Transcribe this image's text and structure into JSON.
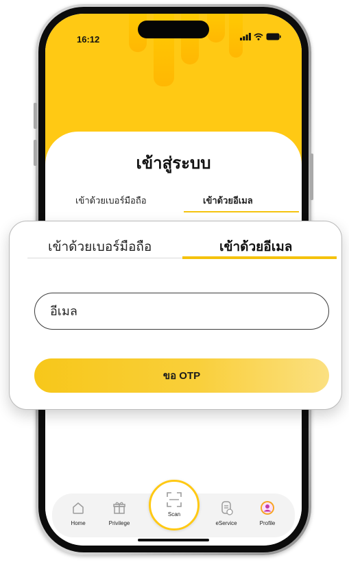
{
  "status_bar": {
    "time": "16:12"
  },
  "login": {
    "title": "เข้าสู่ระบบ",
    "tabs": [
      {
        "label": "เข้าด้วยเบอร์มือถือ",
        "active": false
      },
      {
        "label": "เข้าด้วยอีเมล",
        "active": true
      }
    ]
  },
  "email_form": {
    "email_placeholder": "อีเมล",
    "email_value": "",
    "otp_button_label": "ขอ OTP"
  },
  "bottom_nav": {
    "items": [
      {
        "label": "Home",
        "icon": "home-icon"
      },
      {
        "label": "Privilege",
        "icon": "gift-icon"
      },
      {
        "label": "Scan",
        "icon": "scan-icon"
      },
      {
        "label": "eService",
        "icon": "document-icon"
      },
      {
        "label": "Profile",
        "icon": "profile-icon"
      }
    ]
  },
  "colors": {
    "brand_yellow": "#ffc914",
    "tab_underline": "#f4c20d",
    "text_dark": "#111111"
  }
}
